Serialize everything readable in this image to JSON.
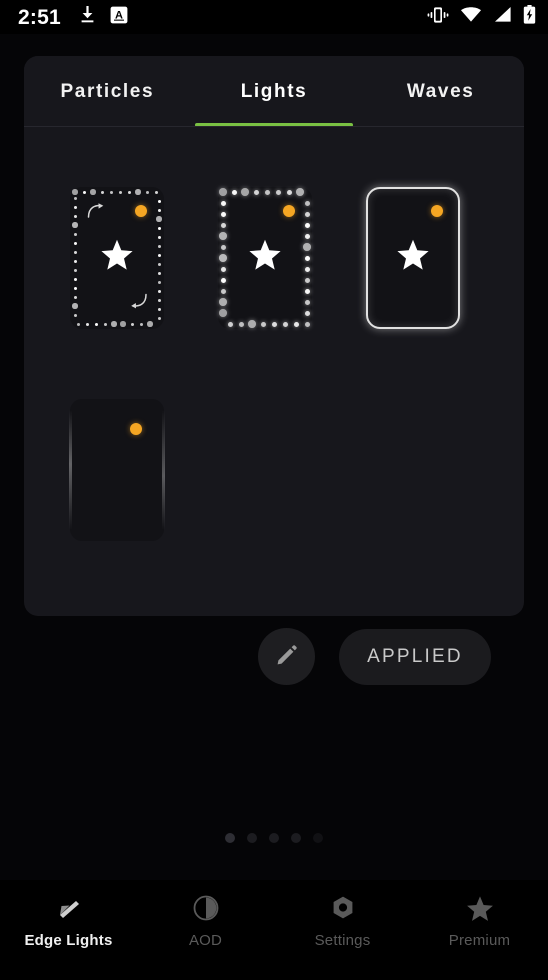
{
  "statusbar": {
    "time": "2:51",
    "left_icons": [
      "download-icon",
      "caption-a-icon"
    ],
    "right_icons": [
      "vibrate-icon",
      "wifi-icon",
      "cellular-signal-icon",
      "battery-charging-icon"
    ]
  },
  "theme": {
    "accent_green": "#7ac143",
    "badge_orange": "#f5a623",
    "panel_bg": "#17171c",
    "page_bg": "#050507",
    "text_primary": "#ffffff",
    "text_muted": "#5a5a5a"
  },
  "tabs": [
    {
      "label": "Particles",
      "active": false
    },
    {
      "label": "Lights",
      "active": true
    },
    {
      "label": "Waves",
      "active": false
    }
  ],
  "effects": [
    {
      "name": "dotted-small-ring-effect",
      "style": "dots-small",
      "has_star": true,
      "has_arrows": true,
      "badge": "premium-badge"
    },
    {
      "name": "dotted-large-ring-effect",
      "style": "dots-large",
      "has_star": true,
      "has_arrows": false,
      "badge": "premium-badge"
    },
    {
      "name": "solid-outline-effect",
      "style": "solid-outline",
      "has_star": true,
      "has_arrows": false,
      "badge": "premium-badge"
    },
    {
      "name": "side-streak-effect",
      "style": "side-streaks",
      "has_star": false,
      "has_arrows": false,
      "badge": "premium-badge"
    }
  ],
  "actions": {
    "edit_icon": "pencil-icon",
    "applied_label": "APPLIED"
  },
  "page_indicator": {
    "count": 5,
    "active_index": 0
  },
  "bottom_nav": [
    {
      "label": "Edge Lights",
      "icon": "edge-lights-icon",
      "active": true
    },
    {
      "label": "AOD",
      "icon": "aod-clock-icon",
      "active": false
    },
    {
      "label": "Settings",
      "icon": "settings-nut-icon",
      "active": false
    },
    {
      "label": "Premium",
      "icon": "premium-star-icon",
      "active": false
    }
  ]
}
